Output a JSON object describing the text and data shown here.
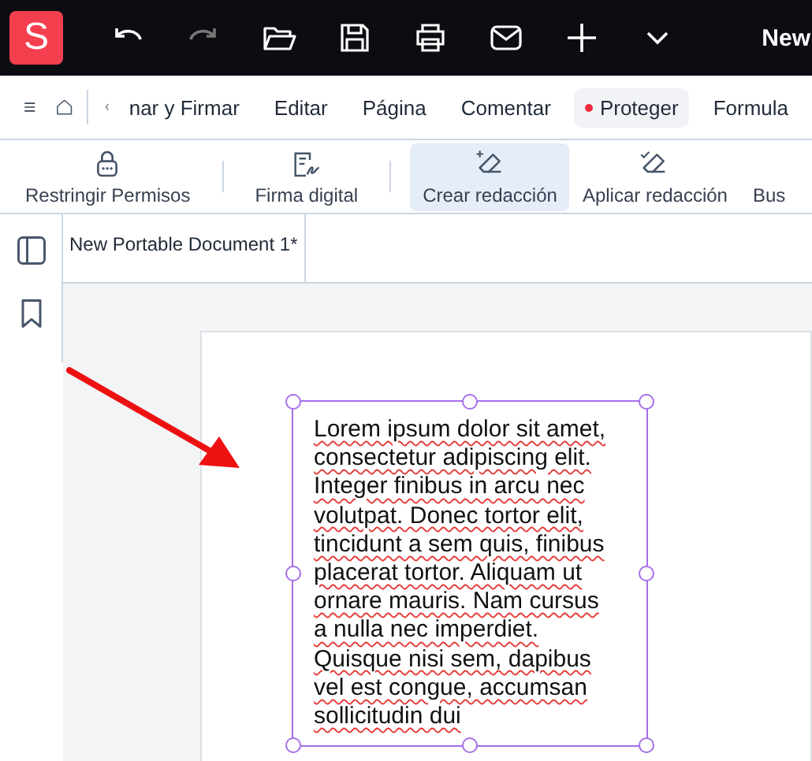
{
  "title_bar": {
    "logo": "S",
    "document_title": "New"
  },
  "ribbon_tabs": [
    {
      "label": "nar y Firmar",
      "selected": false
    },
    {
      "label": "Editar",
      "selected": false
    },
    {
      "label": "Página",
      "selected": false
    },
    {
      "label": "Comentar",
      "selected": false
    },
    {
      "label": "Proteger",
      "selected": true
    },
    {
      "label": "Formula",
      "selected": false
    }
  ],
  "toolbar": [
    {
      "label": "Restringir Permisos",
      "selected": false
    },
    {
      "label": "Firma digital",
      "selected": false
    },
    {
      "label": "Crear redacción",
      "selected": true
    },
    {
      "label": "Aplicar redacción",
      "selected": false
    },
    {
      "label": "Bus",
      "selected": false
    }
  ],
  "document_tab": "New Portable Document 1*",
  "text_box": {
    "lines": [
      "Lorem ipsum dolor sit amet,",
      "consectetur adipiscing elit.",
      "Integer finibus in arcu nec",
      "volutpat. Donec tortor elit,",
      "tincidunt a sem quis, finibus",
      "placerat tortor. Aliquam ut",
      "ornare mauris. Nam cursus",
      "a nulla nec imperdiet.",
      "Quisque nisi sem, dapibus",
      "vel est congue, accumsan",
      "sollicitudin dui"
    ]
  }
}
